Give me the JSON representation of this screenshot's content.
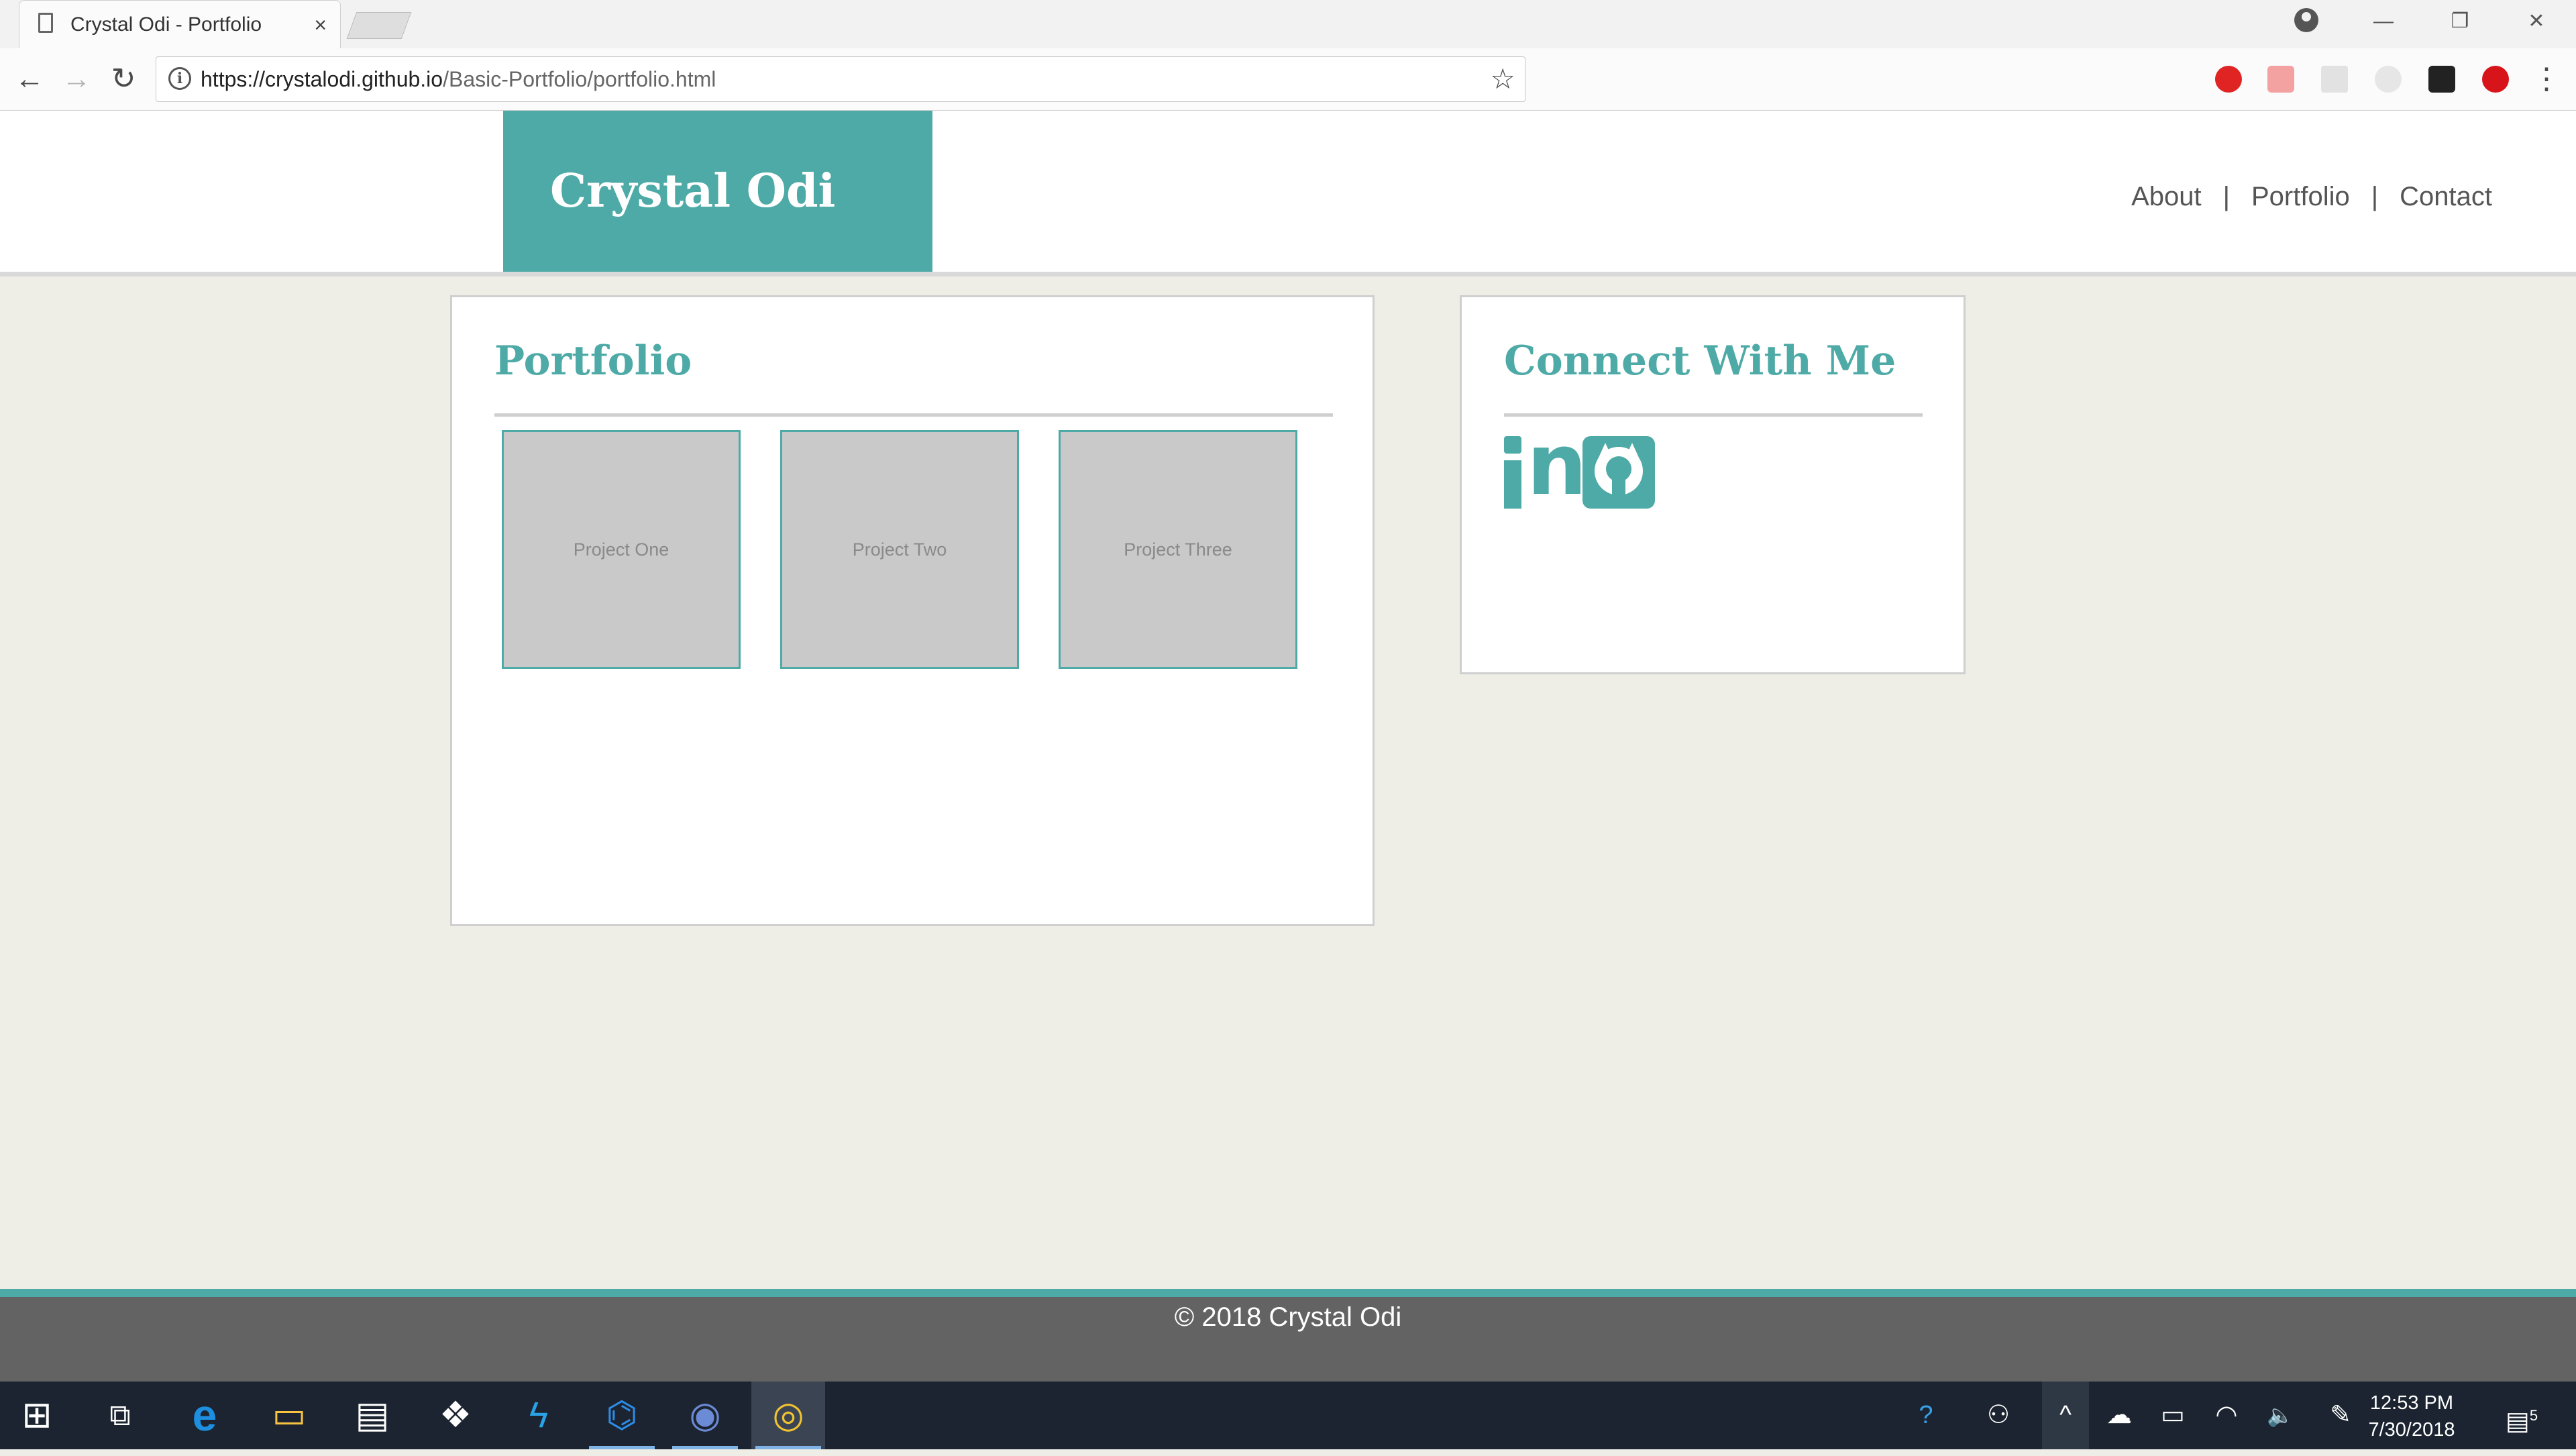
{
  "browser": {
    "tab_title": "Crystal Odi - Portfolio",
    "tab_close": "×",
    "url_host": "https://crystalodi.github.io",
    "url_path": "/Basic-Portfolio/portfolio.html",
    "info_glyph": "i",
    "star_glyph": "☆",
    "back_glyph": "←",
    "forward_glyph": "→",
    "reload_glyph": "↻",
    "menu_glyph": "⋮",
    "minimize_glyph": "—",
    "restore_glyph": "❐",
    "close_glyph": "✕"
  },
  "site": {
    "brand": "Crystal Odi",
    "nav": [
      {
        "label": "About"
      },
      {
        "label": "Portfolio"
      },
      {
        "label": "Contact"
      }
    ],
    "nav_separator": "|",
    "portfolio": {
      "title": "Portfolio",
      "projects": [
        {
          "label": "Project One"
        },
        {
          "label": "Project Two"
        },
        {
          "label": "Project Three"
        }
      ]
    },
    "connect": {
      "title": "Connect With Me",
      "linkedin_glyph": "n",
      "icons": [
        "linkedin-icon",
        "github-icon"
      ]
    },
    "footer": "© 2018 Crystal Odi",
    "colors": {
      "accent": "#4eaaa6",
      "background": "#eeeee7",
      "footer": "#636363"
    }
  },
  "taskbar": {
    "start_glyph": "⊞",
    "apps": [
      {
        "name": "task-view",
        "glyph": "⧉"
      },
      {
        "name": "edge",
        "glyph": "e"
      },
      {
        "name": "file-explorer",
        "glyph": "▭"
      },
      {
        "name": "store",
        "glyph": "▤"
      },
      {
        "name": "dropbox",
        "glyph": "❖"
      },
      {
        "name": "sharp-app",
        "glyph": "ϟ"
      },
      {
        "name": "vscode",
        "glyph": "⌬"
      },
      {
        "name": "app-circle",
        "glyph": "◉"
      },
      {
        "name": "chrome",
        "glyph": "◎"
      }
    ],
    "tray": {
      "help_glyph": "?",
      "people_glyph": "⚇",
      "chevron_glyph": "^",
      "cloud_glyph": "☁",
      "battery_glyph": "▭",
      "wifi_glyph": "◠",
      "volume_glyph": "🔈",
      "pen_glyph": "✎",
      "notification_glyph": "▤",
      "notification_count": "5"
    },
    "time": "12:53 PM",
    "date": "7/30/2018"
  }
}
